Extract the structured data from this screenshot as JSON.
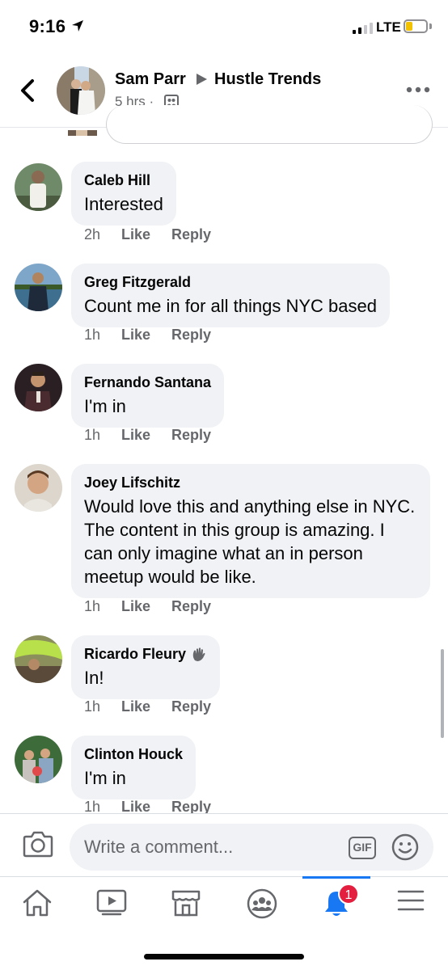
{
  "status_bar": {
    "time": "9:16",
    "network": "LTE"
  },
  "header": {
    "author": "Sam Parr",
    "group": "Hustle Trends",
    "time_ago": "5 hrs",
    "separator": "·"
  },
  "comments": [
    {
      "name": "Caleb Hill",
      "text": "Interested",
      "time": "2h",
      "like": "Like",
      "reply": "Reply"
    },
    {
      "name": "Greg Fitzgerald",
      "text": "Count me in for all things NYC based",
      "time": "1h",
      "like": "Like",
      "reply": "Reply"
    },
    {
      "name": "Fernando Santana",
      "text": "I'm in",
      "time": "1h",
      "like": "Like",
      "reply": "Reply"
    },
    {
      "name": "Joey Lifschitz",
      "text": "Would love this and anything else in NYC. The content in this group is amazing. I can only imagine what an in person meetup would be like.",
      "time": "1h",
      "like": "Like",
      "reply": "Reply"
    },
    {
      "name": "Ricardo Fleury",
      "text": "In!",
      "time": "1h",
      "like": "Like",
      "reply": "Reply",
      "badge_icon": "wave-icon"
    },
    {
      "name": "Clinton Houck",
      "text": "I'm in",
      "time": "1h",
      "like": "Like",
      "reply": "Reply"
    }
  ],
  "composer": {
    "placeholder": "Write a comment...",
    "gif_label": "GIF"
  },
  "tabbar": {
    "items": [
      "home-icon",
      "watch-icon",
      "marketplace-icon",
      "groups-icon",
      "notifications-icon",
      "menu-icon"
    ],
    "notification_count": "1",
    "active": "notifications-icon"
  },
  "colors": {
    "accent": "#1877f2",
    "badge": "#e41e3f",
    "bubble": "#f0f2f5",
    "secondary_text": "#65676b"
  }
}
